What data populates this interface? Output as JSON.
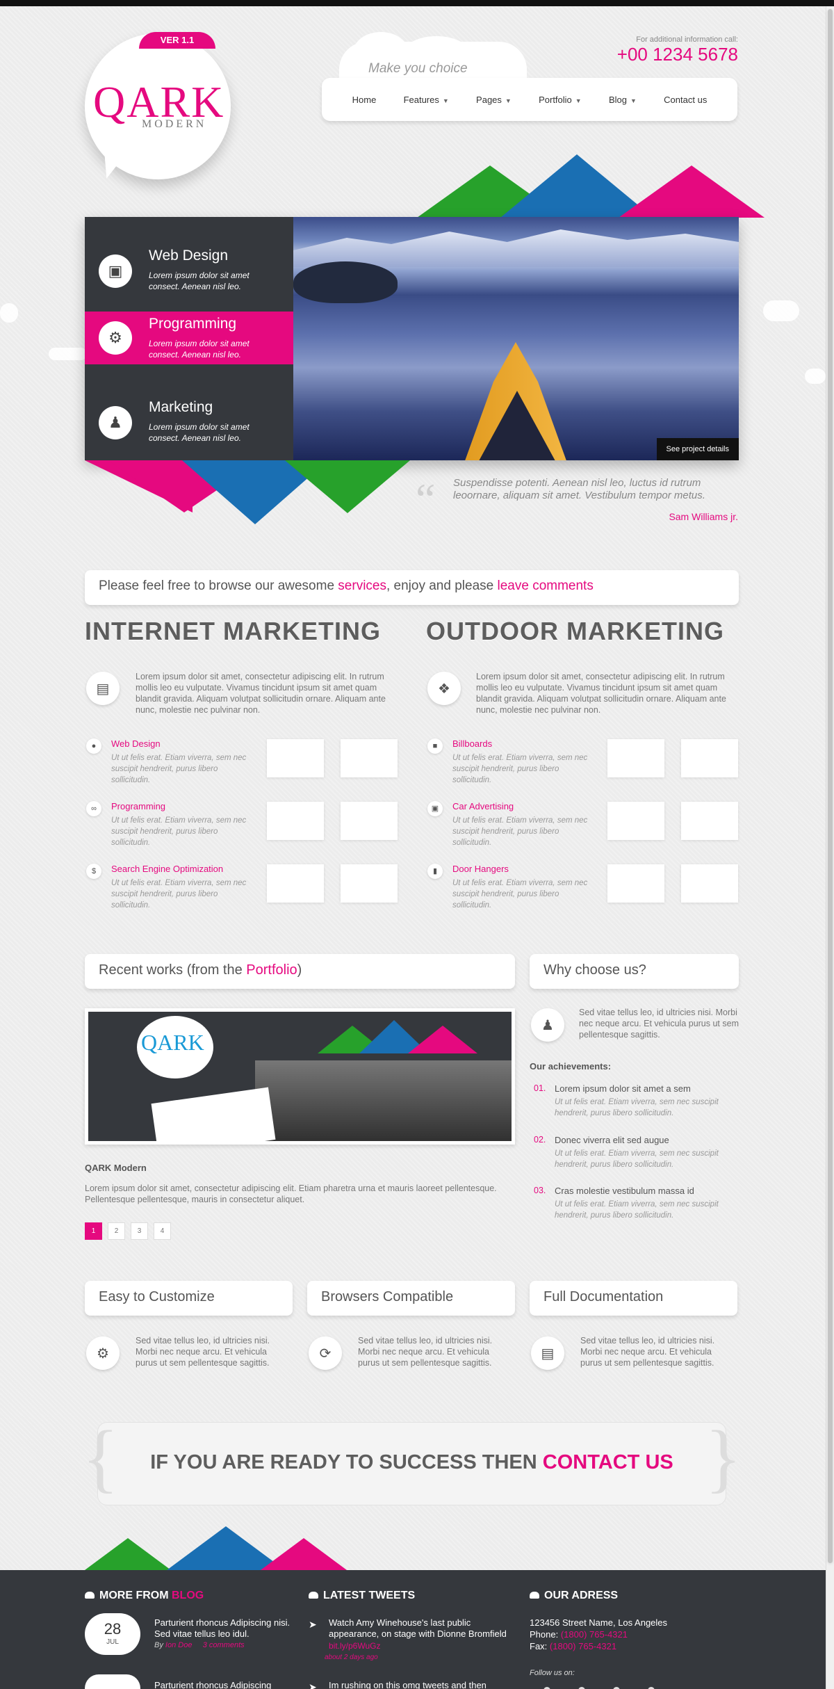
{
  "header": {
    "version": "VER 1.1",
    "logo_main": "QARK",
    "logo_sub": "MODERN",
    "info_label": "For additional information call:",
    "phone": "+00 1234 5678",
    "slogan": "Make you choice",
    "nav": [
      {
        "label": "Home",
        "dropdown": false
      },
      {
        "label": "Features",
        "dropdown": true
      },
      {
        "label": "Pages",
        "dropdown": true
      },
      {
        "label": "Portfolio",
        "dropdown": true
      },
      {
        "label": "Blog",
        "dropdown": true
      },
      {
        "label": "Contact us",
        "dropdown": false
      }
    ]
  },
  "slider": {
    "tabs": [
      {
        "title": "Web Design",
        "desc": "Lorem ipsum dolor sit amet consect. Aenean nisl leo.",
        "icon": "image-icon"
      },
      {
        "title": "Programming",
        "desc": "Lorem ipsum dolor sit amet consect. Aenean nisl leo.",
        "icon": "gears-icon"
      },
      {
        "title": "Marketing",
        "desc": "Lorem ipsum dolor sit amet consect. Aenean nisl leo.",
        "icon": "users-icon"
      }
    ],
    "active_tab": "Programming",
    "see_project": "See project details"
  },
  "quote": {
    "text": "Suspendisse potenti. Aenean nisl leo, luctus id rutrum leoornare, aliquam sit amet. Vestibulum tempor metus.",
    "author": "Sam Williams jr."
  },
  "welcome": {
    "pre": "Please feel free to browse our awesome ",
    "link1": "services",
    "mid": ", enjoy and please ",
    "link2": "leave comments"
  },
  "internet": {
    "title": "INTERNET MARKETING",
    "intro": "Lorem ipsum dolor sit amet, consectetur adipiscing elit. In rutrum mollis leo eu vulputate. Vivamus tincidunt ipsum sit amet quam blandit gravida. Aliquam volutpat sollicitudin ornare. Aliquam ante nunc, molestie nec pulvinar non.",
    "features": [
      {
        "title": "Web Design",
        "desc": "Ut ut felis erat. Etiam viverra, sem nec suscipit hendrerit, purus libero sollicitudin."
      },
      {
        "title": "Programming",
        "desc": "Ut ut felis erat. Etiam viverra, sem nec suscipit hendrerit, purus libero sollicitudin."
      },
      {
        "title": "Search Engine Optimization",
        "desc": "Ut ut felis erat. Etiam viverra, sem nec suscipit hendrerit, purus libero sollicitudin."
      }
    ]
  },
  "outdoor": {
    "title": "OUTDOOR MARKETING",
    "intro": "Lorem ipsum dolor sit amet, consectetur adipiscing elit. In rutrum mollis leo eu vulputate. Vivamus tincidunt ipsum sit amet quam blandit gravida. Aliquam volutpat sollicitudin ornare. Aliquam ante nunc, molestie nec pulvinar non.",
    "features": [
      {
        "title": "Billboards",
        "desc": "Ut ut felis erat. Etiam viverra, sem nec suscipit hendrerit, purus libero sollicitudin."
      },
      {
        "title": "Car Advertising",
        "desc": "Ut ut felis erat. Etiam viverra, sem nec suscipit hendrerit, purus libero sollicitudin."
      },
      {
        "title": "Door Hangers",
        "desc": "Ut ut felis erat. Etiam viverra, sem nec suscipit hendrerit, purus libero sollicitudin."
      }
    ]
  },
  "recent": {
    "pre": "Recent works (from the ",
    "link": "Portfolio",
    "post": ")",
    "logo": "QARK",
    "work_title": "QARK Modern",
    "work_desc": "Lorem ipsum dolor sit amet, consectetur adipiscing elit. Etiam pharetra urna et mauris laoreet pellentesque. Pellentesque pellentesque, mauris in consectetur aliquet.",
    "pages": [
      "1",
      "2",
      "3",
      "4"
    ],
    "current_page": "1"
  },
  "why": {
    "title": "Why choose us?",
    "text": "Sed vitae tellus leo, id ultricies nisi. Morbi nec neque arcu. Et vehicula purus ut sem pellentesque sagittis.",
    "ach_title": "Our achievements:",
    "achievements": [
      {
        "num": "01.",
        "title": "Lorem ipsum dolor sit amet a sem",
        "desc": "Ut ut felis erat. Etiam viverra, sem nec suscipit hendrerit, purus libero sollicitudin."
      },
      {
        "num": "02.",
        "title": "Donec viverra elit sed augue",
        "desc": "Ut ut felis erat. Etiam viverra, sem nec suscipit hendrerit, purus libero sollicitudin."
      },
      {
        "num": "03.",
        "title": "Cras molestie vestibulum massa id",
        "desc": "Ut ut felis erat. Etiam viverra, sem nec suscipit hendrerit, purus libero sollicitudin."
      }
    ]
  },
  "features3": [
    {
      "title": "Easy to Customize",
      "text": "Sed vitae tellus leo, id ultricies nisi. Morbi nec neque arcu. Et vehicula purus ut sem pellentesque sagittis."
    },
    {
      "title": "Browsers Compatible",
      "text": "Sed vitae tellus leo, id ultricies nisi. Morbi nec neque arcu. Et vehicula purus ut sem pellentesque sagittis."
    },
    {
      "title": "Full Documentation",
      "text": "Sed vitae tellus leo, id ultricies nisi. Morbi nec neque arcu. Et vehicula purus ut sem pellentesque sagittis."
    }
  ],
  "cta": {
    "text": "IF YOU ARE READY TO SUCCESS THEN ",
    "link": "CONTACT US"
  },
  "footer": {
    "blog_head": "MORE FROM ",
    "blog_head_link": "BLOG",
    "blog_day": "28",
    "blog_month": "JUL",
    "blog_title": "Parturient rhoncus Adipiscing nisi. Sed vitae tellus leo idul.",
    "blog_by": "By",
    "blog_author": "Ion Doe",
    "blog_comments": "3 comments",
    "blog_title2": "Parturient rhoncus Adipiscing",
    "tweets_head": "LATEST TWEETS",
    "tweet": "Watch Amy Winehouse's last public appearance, on stage with Dionne Bromfield",
    "tweet_link": "bit.ly/p6WuGz",
    "tweet_ago": "about 2 days ago",
    "tweet2": "Im rushing on this omg tweets and then",
    "address_head": "OUR ADRESS",
    "address": "123456 Street Name, Los Angeles",
    "phone_label": "Phone:",
    "phone": "(1800) 765-4321",
    "fax_label": "Fax:",
    "fax": "(1800) 765-4321",
    "follow": "Follow us on:"
  },
  "colors": {
    "accent": "#e5097f",
    "dark": "#35383d",
    "green": "#26a12b",
    "blue": "#1a6fb3"
  }
}
